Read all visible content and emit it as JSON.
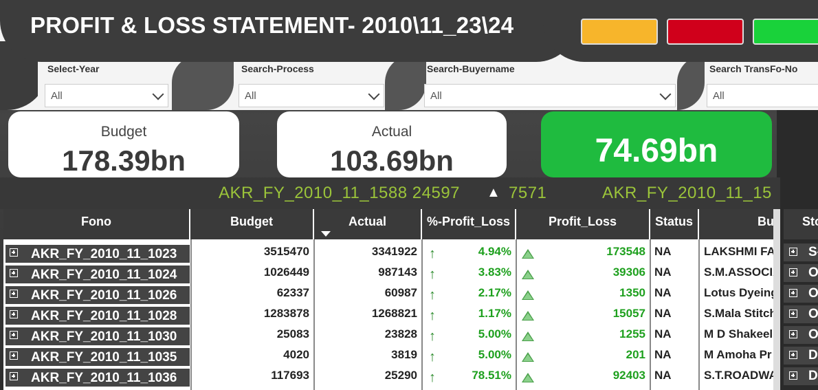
{
  "header": {
    "title": "PROFIT & LOSS STATEMENT- 2010\\11_23\\24",
    "swatches": [
      {
        "name": "amber-indicator",
        "color": "#f7b52b"
      },
      {
        "name": "red-indicator",
        "color": "#d0001b"
      },
      {
        "name": "green-indicator",
        "color": "#19d23a"
      }
    ]
  },
  "filters": [
    {
      "label": "Select-Year",
      "value": "All"
    },
    {
      "label": "Search-Process",
      "value": "All"
    },
    {
      "label": "Search-Buyername",
      "value": "All"
    },
    {
      "label": "Search TransFo-No",
      "value": "All"
    }
  ],
  "cards": {
    "budget": {
      "label": "Budget",
      "value": "178.39bn"
    },
    "actual": {
      "label": "Actual",
      "value": "103.69bn"
    },
    "profit": {
      "value": "74.69bn"
    }
  },
  "ticker": [
    {
      "text": "AKR_FY_2010_11_1588  24597"
    },
    {
      "text": "7571"
    },
    {
      "text": "AKR_FY_2010_11_15"
    }
  ],
  "table": {
    "columns": [
      "Fono",
      "Budget",
      "Actual",
      "%-Profit_Loss",
      "Profit_Loss",
      "Status",
      "Bu"
    ],
    "side_column": "Sto",
    "rows": [
      {
        "fono": "AKR_FY_2010_11_1023",
        "budget": "3515470",
        "actual": "3341922",
        "pct": "4.94%",
        "pl": "173548",
        "status": "NA",
        "buyer": "LAKSHMI FA",
        "side": "S-"
      },
      {
        "fono": "AKR_FY_2010_11_1024",
        "budget": "1026449",
        "actual": "987143",
        "pct": "3.83%",
        "pl": "39306",
        "status": "NA",
        "buyer": "S.M.ASSOCIA",
        "side": "O"
      },
      {
        "fono": "AKR_FY_2010_11_1026",
        "budget": "62337",
        "actual": "60987",
        "pct": "2.17%",
        "pl": "1350",
        "status": "NA",
        "buyer": "Lotus Dyeing",
        "side": "O"
      },
      {
        "fono": "AKR_FY_2010_11_1028",
        "budget": "1283878",
        "actual": "1268821",
        "pct": "1.17%",
        "pl": "15057",
        "status": "NA",
        "buyer": "S.Mala Stitch",
        "side": "O"
      },
      {
        "fono": "AKR_FY_2010_11_1030",
        "budget": "25083",
        "actual": "23828",
        "pct": "5.00%",
        "pl": "1255",
        "status": "NA",
        "buyer": "M D Shakeel",
        "side": "O"
      },
      {
        "fono": "AKR_FY_2010_11_1035",
        "budget": "4020",
        "actual": "3819",
        "pct": "5.00%",
        "pl": "201",
        "status": "NA",
        "buyer": "M Amoha Pr",
        "side": "D"
      },
      {
        "fono": "AKR_FY_2010_11_1036",
        "budget": "117693",
        "actual": "25290",
        "pct": "78.51%",
        "pl": "92403",
        "status": "NA",
        "buyer": "S.T.ROADWA",
        "side": "D"
      }
    ]
  }
}
